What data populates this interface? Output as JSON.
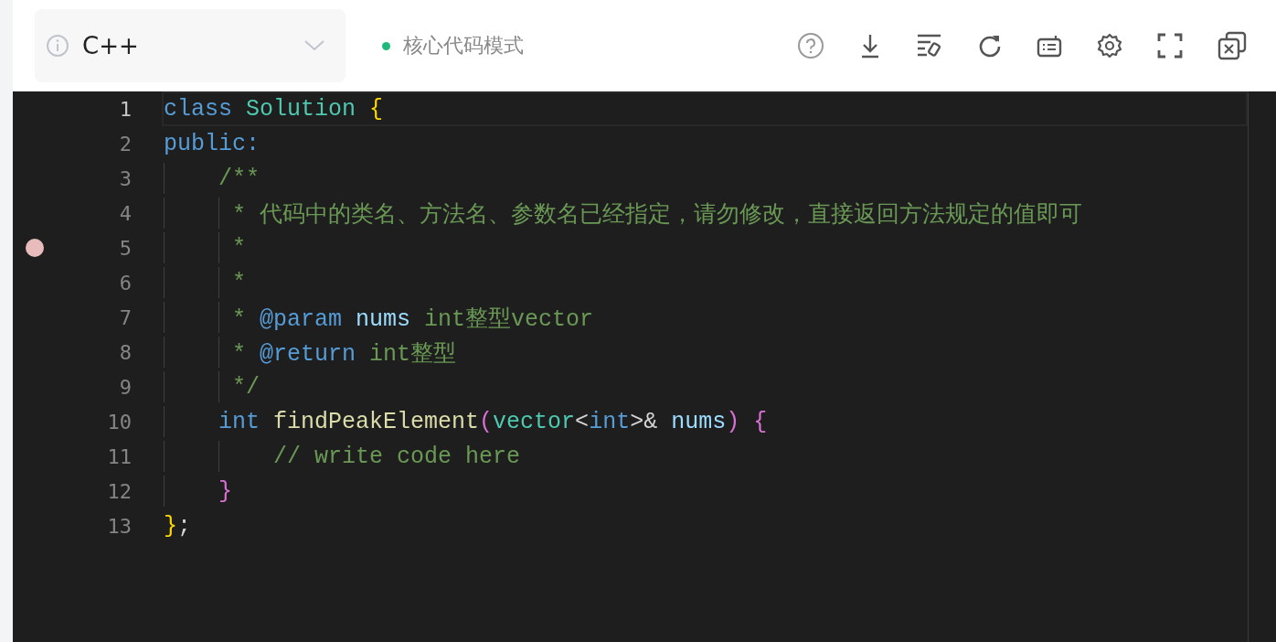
{
  "toolbar": {
    "language": "C++",
    "mode": "核心代码模式"
  },
  "editor": {
    "lines": [
      {
        "number": "1",
        "current": true,
        "breakpoint": false,
        "tokens": [
          {
            "kind": "keyword",
            "text": "class "
          },
          {
            "kind": "type",
            "text": "Solution "
          },
          {
            "kind": "brace",
            "text": "{"
          }
        ]
      },
      {
        "number": "2",
        "current": false,
        "breakpoint": false,
        "tokens": [
          {
            "kind": "keyword",
            "text": "public:"
          }
        ]
      },
      {
        "number": "3",
        "current": false,
        "breakpoint": false,
        "tokens": [
          {
            "kind": "comment",
            "text": "    /**"
          }
        ]
      },
      {
        "number": "4",
        "current": false,
        "breakpoint": false,
        "tokens": [
          {
            "kind": "comment",
            "text": "     * 代码中的类名、方法名、参数名已经指定，请勿修改，直接返回方法规定的值即可"
          }
        ]
      },
      {
        "number": "5",
        "current": false,
        "breakpoint": true,
        "tokens": [
          {
            "kind": "comment",
            "text": "     *"
          }
        ]
      },
      {
        "number": "6",
        "current": false,
        "breakpoint": false,
        "tokens": [
          {
            "kind": "comment",
            "text": "     *"
          }
        ]
      },
      {
        "number": "7",
        "current": false,
        "breakpoint": false,
        "tokens": [
          {
            "kind": "comment",
            "text": "     * "
          },
          {
            "kind": "doctag",
            "text": "@param "
          },
          {
            "kind": "variable",
            "text": "nums"
          },
          {
            "kind": "comment",
            "text": " int整型vector"
          }
        ]
      },
      {
        "number": "8",
        "current": false,
        "breakpoint": false,
        "tokens": [
          {
            "kind": "comment",
            "text": "     * "
          },
          {
            "kind": "doctag",
            "text": "@return"
          },
          {
            "kind": "comment",
            "text": " int整型"
          }
        ]
      },
      {
        "number": "9",
        "current": false,
        "breakpoint": false,
        "tokens": [
          {
            "kind": "comment",
            "text": "     */"
          }
        ]
      },
      {
        "number": "10",
        "current": false,
        "breakpoint": false,
        "tokens": [
          {
            "kind": "keyword",
            "text": "    int "
          },
          {
            "kind": "function",
            "text": "findPeakElement"
          },
          {
            "kind": "paren",
            "text": "("
          },
          {
            "kind": "type",
            "text": "vector"
          },
          {
            "kind": "plain",
            "text": "<"
          },
          {
            "kind": "keyword",
            "text": "int"
          },
          {
            "kind": "plain",
            "text": ">& "
          },
          {
            "kind": "variable",
            "text": "nums"
          },
          {
            "kind": "paren",
            "text": ") {"
          }
        ]
      },
      {
        "number": "11",
        "current": false,
        "breakpoint": false,
        "tokens": [
          {
            "kind": "comment",
            "text": "        // write code here"
          }
        ]
      },
      {
        "number": "12",
        "current": false,
        "breakpoint": false,
        "tokens": [
          {
            "kind": "paren",
            "text": "    }"
          }
        ]
      },
      {
        "number": "13",
        "current": false,
        "breakpoint": false,
        "tokens": [
          {
            "kind": "brace",
            "text": "}"
          },
          {
            "kind": "plain",
            "text": ";"
          }
        ]
      }
    ]
  }
}
